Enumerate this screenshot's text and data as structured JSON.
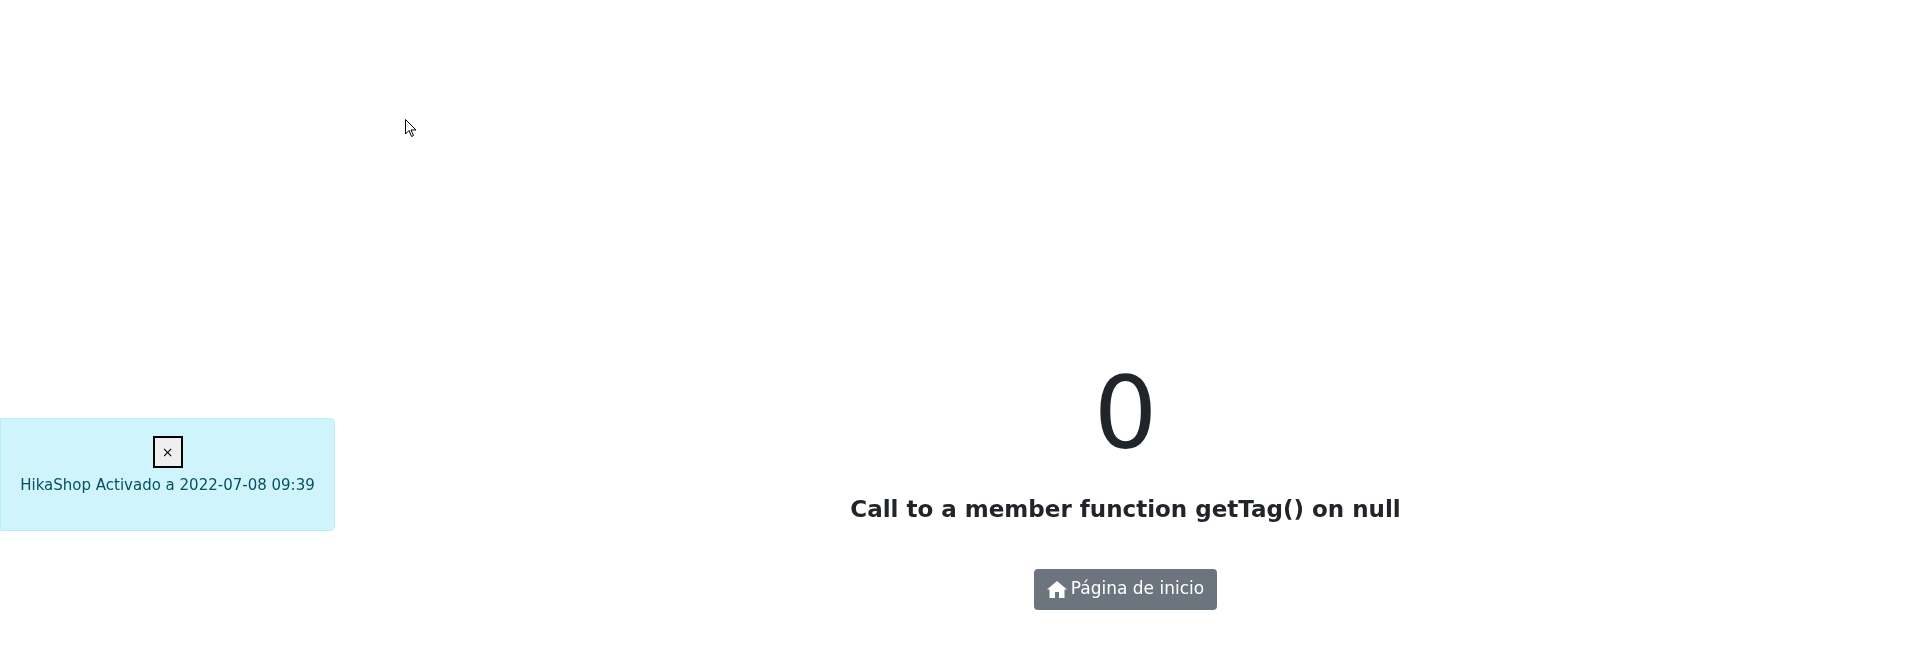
{
  "alert": {
    "close_label": "×",
    "message": "HikaShop Activado a 2022-07-08 09:39"
  },
  "error": {
    "code": "0",
    "message": "Call to a member function getTag() on null"
  },
  "home_button": {
    "label": "Página de inicio"
  }
}
